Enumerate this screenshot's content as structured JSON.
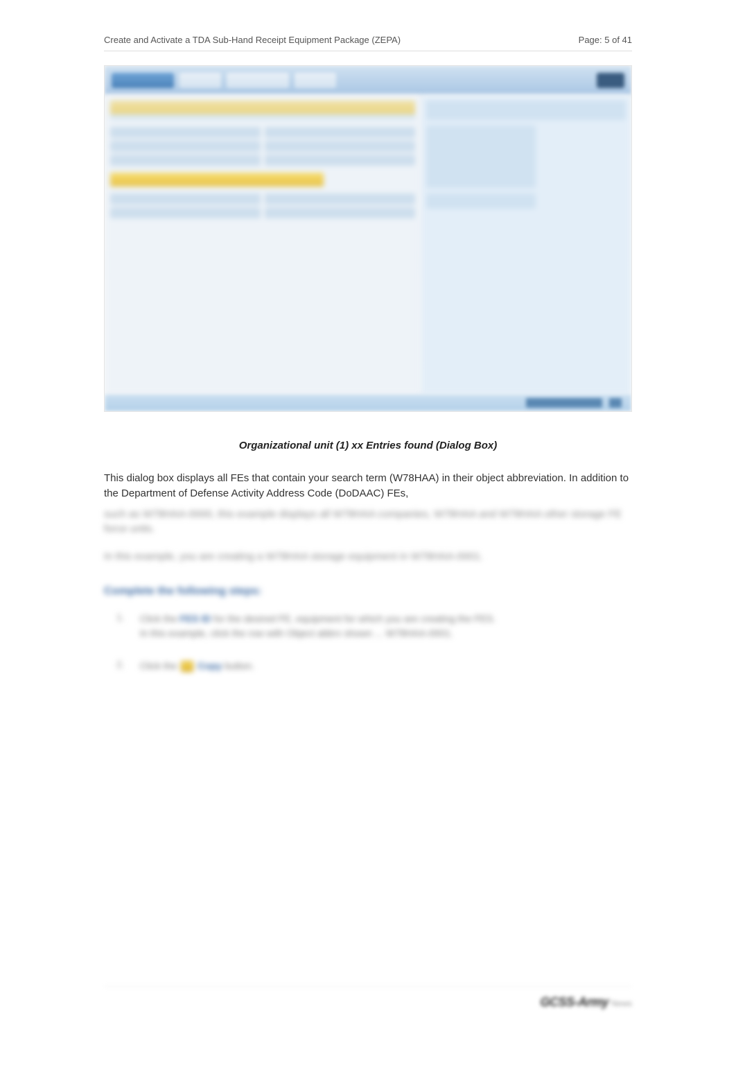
{
  "header": {
    "title": "Create and Activate a TDA Sub-Hand Receipt Equipment Package (ZEPA)",
    "page_indicator": "Page: 5 of 41"
  },
  "caption": "Organizational unit (1) xx Entries found (Dialog Box)",
  "paragraph_visible": "This dialog box displays all FEs that contain your search term (W78HAA) in their object abbreviation. In addition to the Department of Defense Activity Address Code (DoDAAC) FEs,",
  "paragraph_obscured_1": "such as W78HAA-0000, this example displays all W78HAA companies, W78HAA and W78HAA other storage FE force units.",
  "paragraph_obscured_2": "In this example, you are creating a W78HAA storage equipment in W78HAA-0001.",
  "section_heading_obscured": "Complete the following steps:",
  "steps": [
    {
      "num": "1.",
      "text_pre": "Click the ",
      "kw": "FES ID",
      "text_mid": " for the desired FE, equipment for which you are creating the",
      "line2": "In this example, click the row with Object abbrv shown ... W78HAA-0001."
    },
    {
      "num": "2.",
      "text_pre": "Click the ",
      "kw2": "Copy",
      "text_post": " button."
    }
  ],
  "footer": {
    "logo": "GCSS-Army",
    "sub": "News"
  }
}
